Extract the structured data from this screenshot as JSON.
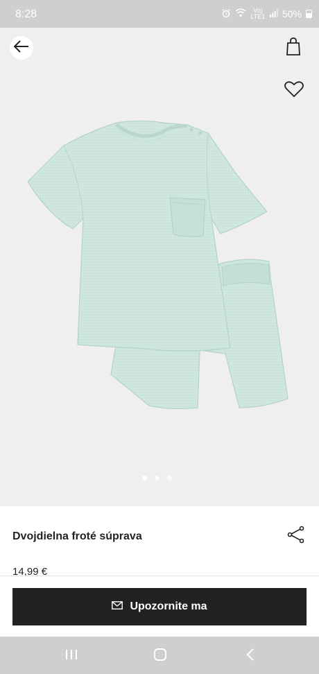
{
  "status_bar": {
    "time": "8:28",
    "network": "Vo) LTE1",
    "battery": "50%"
  },
  "header": {
    "back_icon": "arrow-left-icon",
    "bag_icon": "shopping-bag-icon",
    "favorite_icon": "heart-icon"
  },
  "gallery": {
    "image": "mint terry t-shirt and shorts set",
    "pages": 3,
    "active_page": 1
  },
  "product": {
    "title": "Dvojdielna froté súprava",
    "price": "14,99 €",
    "share_icon": "share-icon"
  },
  "cta": {
    "label": "Upozornite ma",
    "icon": "envelope-icon"
  },
  "colors": {
    "garment": "#cfe7dd",
    "hero_bg": "#efefef",
    "cta_bg": "#222222"
  },
  "nav_bar": {
    "items": [
      "recent-apps",
      "home",
      "back"
    ]
  }
}
